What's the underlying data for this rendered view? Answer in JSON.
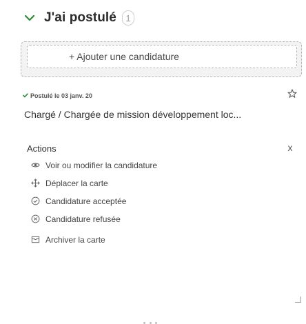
{
  "column": {
    "title": "J'ai postulé",
    "count": "1",
    "add_button_label": "+ Ajouter une candidature"
  },
  "card": {
    "status_badge": "Postulé le 03 janv. 20",
    "title": "Chargé / Chargée de mission développement loc...",
    "actions_label": "Actions",
    "close_label": "x",
    "menu": [
      {
        "label": "Voir ou modifier la candidature",
        "icon": "eye-icon"
      },
      {
        "label": "Déplacer la carte",
        "icon": "move-icon"
      },
      {
        "label": "Candidature acceptée",
        "icon": "check-circle-icon"
      },
      {
        "label": "Candidature refusée",
        "icon": "x-circle-icon"
      },
      {
        "label": "Archiver la carte",
        "icon": "archive-icon"
      }
    ]
  },
  "colors": {
    "accent": "#2e8a3a",
    "text": "#333333",
    "muted": "#9a9a9a"
  }
}
